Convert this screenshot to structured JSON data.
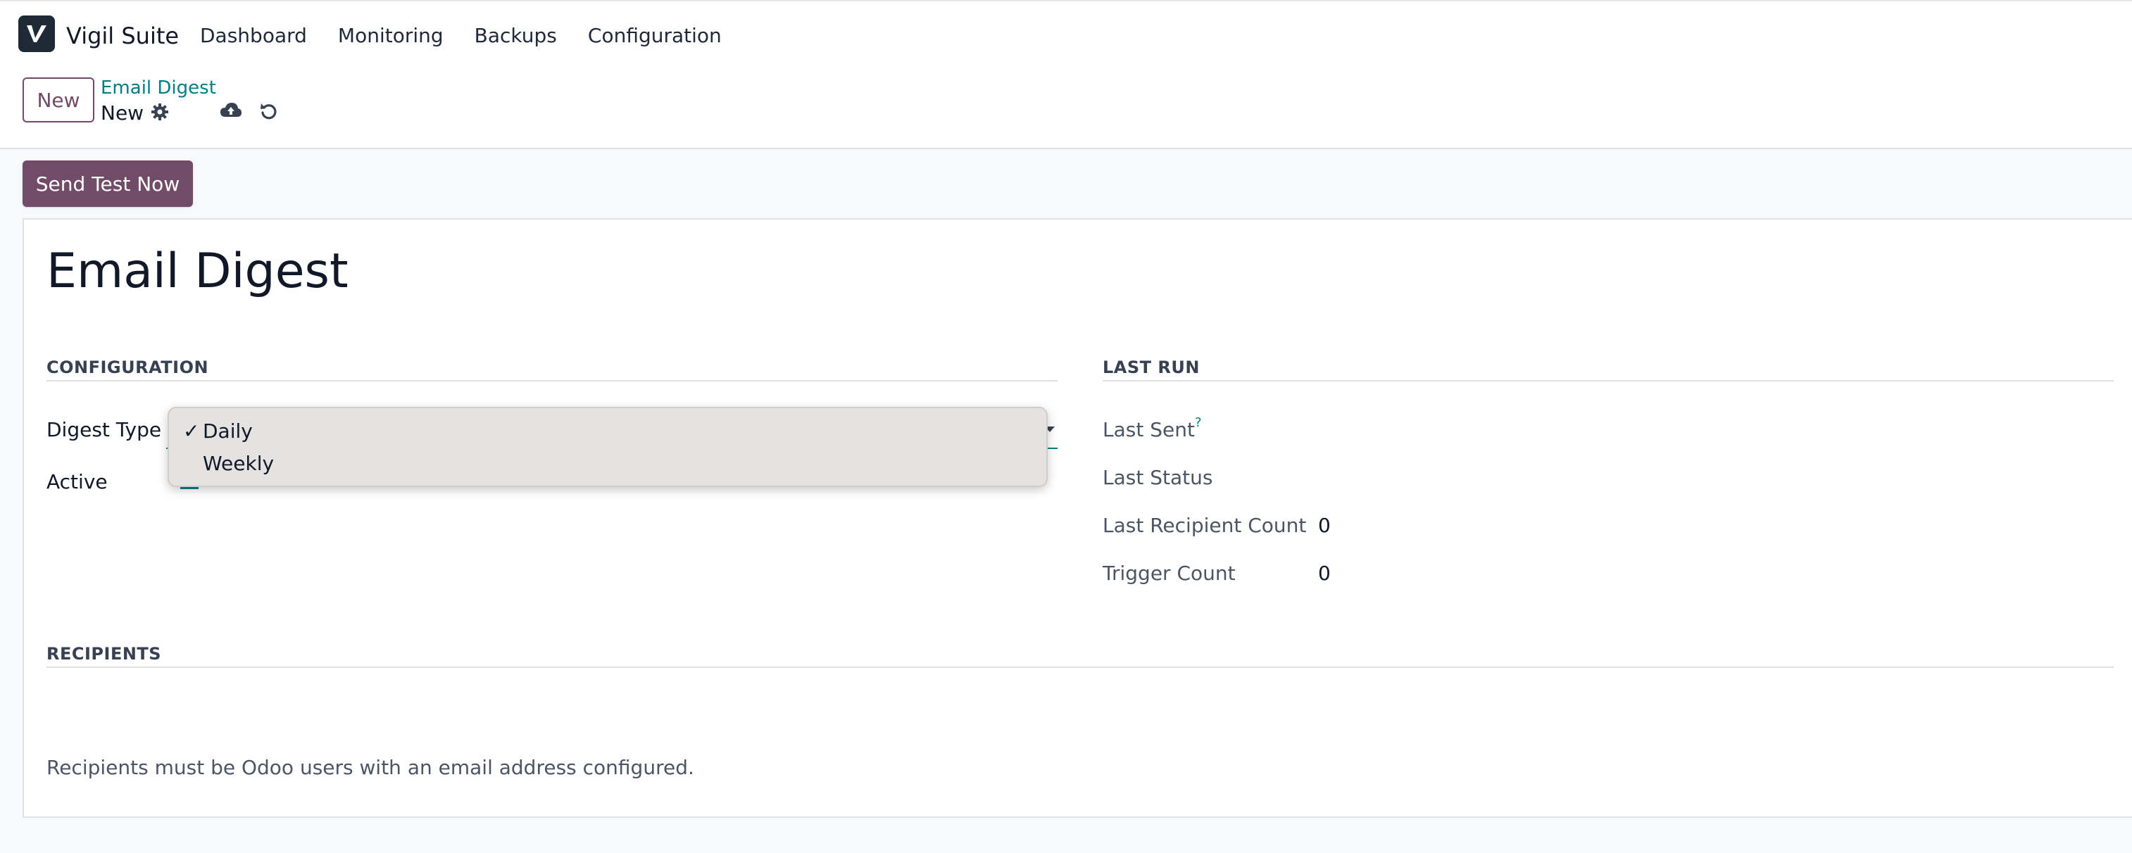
{
  "app": {
    "name": "Vigil Suite"
  },
  "nav": {
    "items": [
      "Dashboard",
      "Monitoring",
      "Backups",
      "Configuration"
    ]
  },
  "controlbar": {
    "new_button": "New",
    "breadcrumb_parent": "Email Digest",
    "breadcrumb_current": "New",
    "icons": [
      "gear-icon",
      "cloud-upload-icon",
      "undo-icon"
    ]
  },
  "actions": {
    "send_test": "Send Test Now"
  },
  "record": {
    "title": "Email Digest"
  },
  "configuration": {
    "heading": "CONFIGURATION",
    "digest_type_label": "Digest Type",
    "active_label": "Active",
    "digest_type_options": [
      "Daily",
      "Weekly"
    ],
    "selected_option": "Daily",
    "check_mark": "✓"
  },
  "last_run": {
    "heading": "LAST RUN",
    "last_sent_label": "Last Sent",
    "last_sent_help": "?",
    "last_status_label": "Last Status",
    "last_recipient_count_label": "Last Recipient Count",
    "last_recipient_count_value": "0",
    "trigger_count_label": "Trigger Count",
    "trigger_count_value": "0"
  },
  "recipients": {
    "heading": "RECIPIENTS",
    "note": "Recipients must be Odoo users with an email address configured."
  },
  "colors": {
    "brand": "#714b67",
    "accent": "#017e84",
    "logo_bg": "#1f2a37"
  }
}
